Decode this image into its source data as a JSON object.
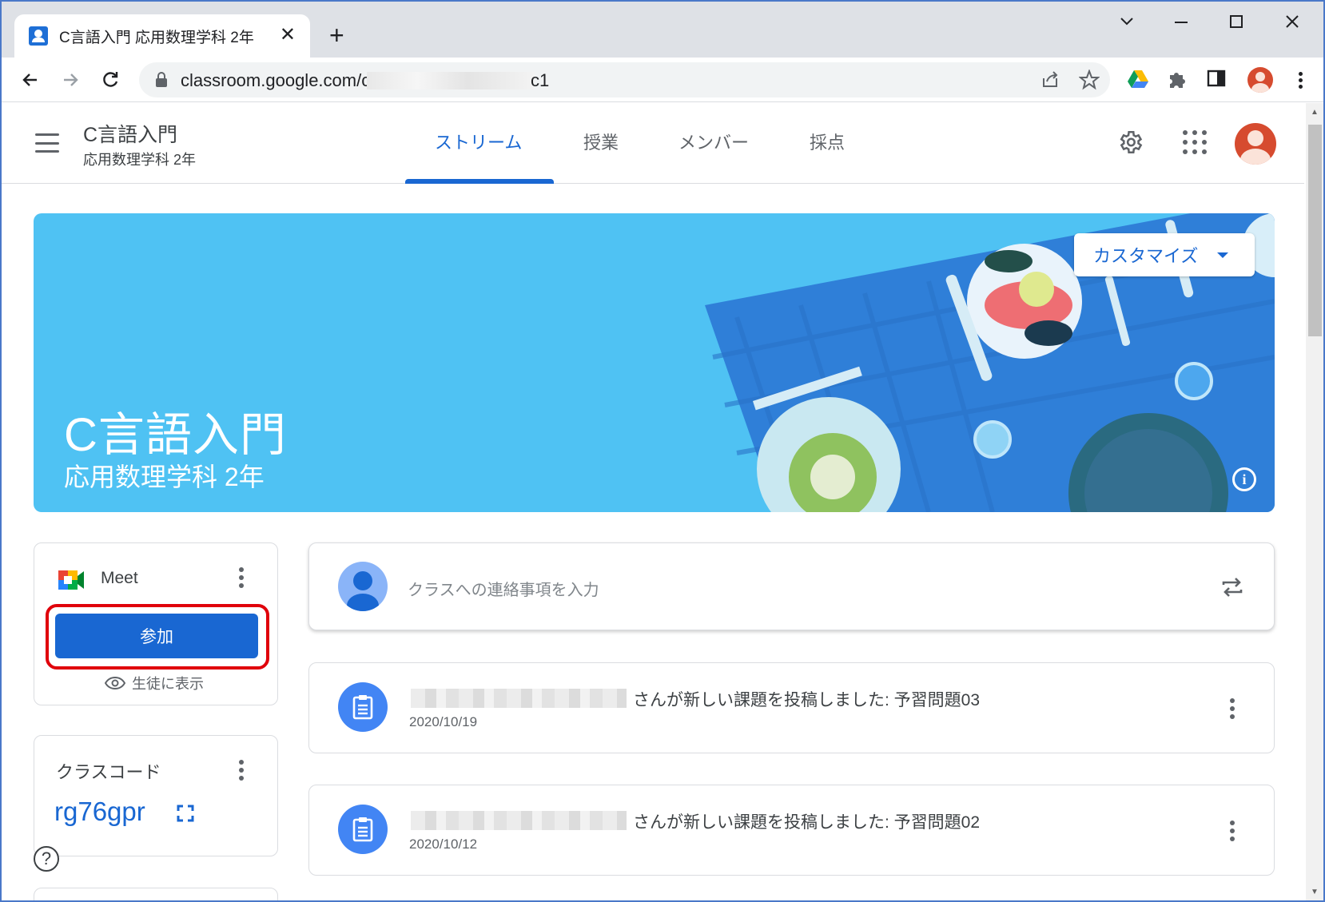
{
  "browser": {
    "tab_title": "C言語入門 応用数理学科 2年",
    "tab_close": "✕",
    "new_tab": "+",
    "url_visible_start": "classroom.google.com/c/",
    "url_visible_end": "c1"
  },
  "appbar": {
    "course_title": "C言語入門",
    "course_subtitle": "応用数理学科 2年",
    "tabs": [
      {
        "label": "ストリーム",
        "active": true
      },
      {
        "label": "授業",
        "active": false
      },
      {
        "label": "メンバー",
        "active": false
      },
      {
        "label": "採点",
        "active": false
      }
    ]
  },
  "banner": {
    "title": "C言語入門",
    "subtitle": "応用数理学科 2年",
    "customize_label": "カスタマイズ",
    "bg_color": "#4fc2f3"
  },
  "meet": {
    "label": "Meet",
    "join_label": "参加",
    "show_students_label": "生徒に表示"
  },
  "class_code": {
    "label": "クラスコード",
    "value": "rg76gpr"
  },
  "announce": {
    "placeholder": "クラスへの連絡事項を入力"
  },
  "posts": [
    {
      "text": "さんが新しい課題を投稿しました: 予習問題03",
      "date": "2020/10/19"
    },
    {
      "text": "さんが新しい課題を投稿しました: 予習問題02",
      "date": "2020/10/12"
    }
  ],
  "colors": {
    "accent": "#1967d2",
    "highlight_outline": "#e0000b"
  },
  "icons": [
    "back-icon",
    "forward-icon",
    "reload-icon",
    "lock-icon",
    "share-icon",
    "star-icon",
    "drive-icon",
    "extensions-icon",
    "side-panel-icon",
    "more-icon",
    "hamburger-icon",
    "gear-icon",
    "apps-icon",
    "info-icon",
    "eye-icon",
    "expand-icon",
    "help-icon",
    "repost-icon",
    "assignment-icon"
  ]
}
